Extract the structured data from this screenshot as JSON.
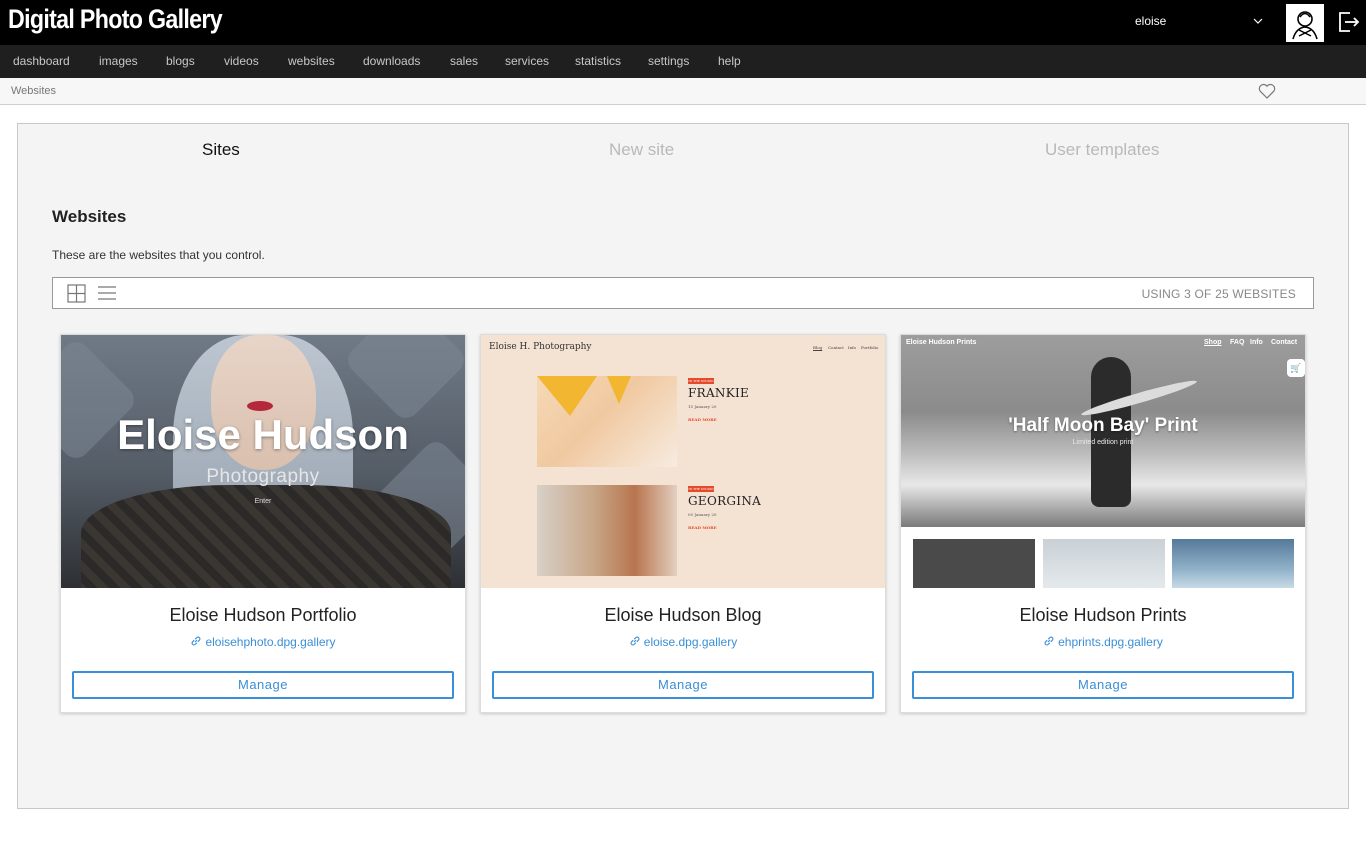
{
  "app": {
    "title": "Digital Photo Gallery",
    "user": "eloise"
  },
  "nav": {
    "items": [
      "dashboard",
      "images",
      "blogs",
      "videos",
      "websites",
      "downloads",
      "sales",
      "services",
      "statistics",
      "settings",
      "help"
    ]
  },
  "breadcrumb": "Websites",
  "tabs": [
    {
      "label": "Sites",
      "active": true
    },
    {
      "label": "New site",
      "active": false
    },
    {
      "label": "User templates",
      "active": false
    }
  ],
  "section": {
    "title": "Websites",
    "description": "These are the websites that you control."
  },
  "toolbar": {
    "usage": "USING 3 OF 25 WEBSITES",
    "view_modes": [
      "grid-icon",
      "list-icon"
    ]
  },
  "cards": [
    {
      "title": "Eloise Hudson Portfolio",
      "url": "eloisehphoto.dpg.gallery",
      "button": "Manage",
      "preview": {
        "headline": "Eloise Hudson",
        "subtitle": "Photography",
        "enter": "Enter"
      }
    },
    {
      "title": "Eloise Hudson Blog",
      "url": "eloise.dpg.gallery",
      "button": "Manage",
      "preview": {
        "brand": "Eloise H. Photography",
        "nav": [
          "Blog",
          "Contact",
          "Info",
          "Portfolio"
        ],
        "posts": [
          {
            "tag": "IN THE STUDIO",
            "title": "FRANKIE",
            "date": "15 January 20",
            "more": "READ MORE"
          },
          {
            "tag": "IN THE STUDIO",
            "title": "GEORGINA",
            "date": "05 January 20",
            "more": "READ MORE"
          }
        ]
      }
    },
    {
      "title": "Eloise Hudson Prints",
      "url": "ehprints.dpg.gallery",
      "button": "Manage",
      "preview": {
        "brand": "Eloise Hudson Prints",
        "nav": [
          "Shop",
          "FAQ",
          "Info",
          "Contact"
        ],
        "headline": "'Half Moon Bay' Print",
        "subtitle": "Limited edition print"
      }
    }
  ],
  "colors": {
    "accent": "#3a8fd6",
    "topbar": "#000000",
    "navbar": "#1f1f1f",
    "panel": "#f4f4f4"
  }
}
